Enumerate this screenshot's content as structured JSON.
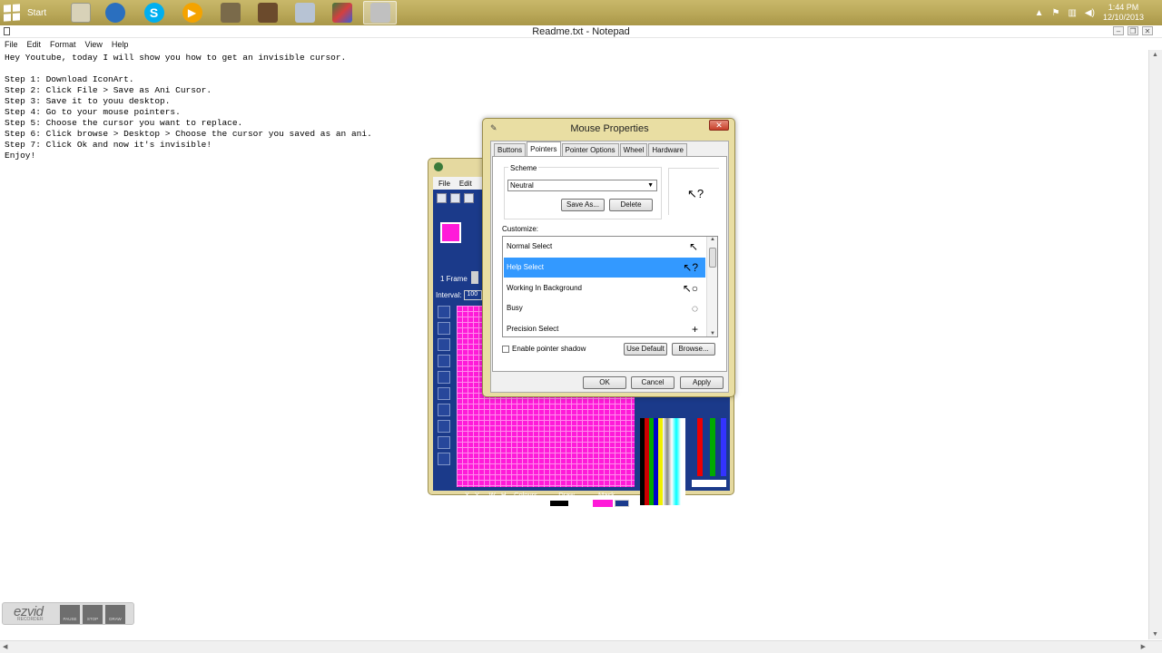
{
  "taskbar": {
    "start_label": "Start",
    "apps": [
      {
        "name": "file-explorer-icon",
        "color": "#d8d2b8"
      },
      {
        "name": "browser-icon",
        "color": "#2a6fbf"
      },
      {
        "name": "skype-icon",
        "color": "#00aff0"
      },
      {
        "name": "media-player-icon",
        "color": "#f4a300"
      },
      {
        "name": "gimp-icon",
        "color": "#7a6a4a"
      },
      {
        "name": "minecraft-icon",
        "color": "#6b4a2c"
      },
      {
        "name": "notepad-icon",
        "color": "#b7c3d4"
      },
      {
        "name": "paint-icon",
        "color": "#3b7a3b"
      },
      {
        "name": "iconart-icon",
        "color": "#c0c0c0"
      }
    ],
    "time": "1:44 PM",
    "date": "12/10/2013"
  },
  "notepad": {
    "title": "Readme.txt - Notepad",
    "menu": [
      "File",
      "Edit",
      "Format",
      "View",
      "Help"
    ],
    "text": "Hey Youtube, today I will show you how to get an invisible cursor.\n\nStep 1: Download IconArt.\nStep 2: Click File > Save as Ani Cursor.\nStep 3: Save it to youu desktop.\nStep 4: Go to your mouse pointers.\nStep 5: Choose the cursor you want to replace.\nStep 6: Click browse > Desktop > Choose the cursor you saved as an ani.\nStep 7: Click Ok and now it's invisible!\nEnjoy!"
  },
  "iconart": {
    "menu": [
      "File",
      "Edit"
    ],
    "frame_label": "1 Frame",
    "interval_label": "Interval:",
    "interval_value": "100",
    "status": {
      "xy_label": "X , Y",
      "xy_value": "(17,1)",
      "wh_label": "W , H",
      "wh_value": "(0,0)",
      "colours_label": "Colours",
      "colours_value": "1",
      "draw_label": "Draw",
      "mask_label": "Mask"
    },
    "current_color": "#ff1ad9"
  },
  "mouse_properties": {
    "title": "Mouse Properties",
    "tabs": [
      "Buttons",
      "Pointers",
      "Pointer Options",
      "Wheel",
      "Hardware"
    ],
    "selected_tab": "Pointers",
    "scheme_label": "Scheme",
    "scheme_value": "Neutral",
    "save_as_label": "Save As...",
    "delete_label": "Delete",
    "customize_label": "Customize:",
    "list": [
      {
        "label": "Normal Select",
        "cursor": "↖"
      },
      {
        "label": "Help Select",
        "cursor": "↖?"
      },
      {
        "label": "Working In Background",
        "cursor": "↖○"
      },
      {
        "label": "Busy",
        "cursor": "◌"
      },
      {
        "label": "Precision Select",
        "cursor": "+"
      }
    ],
    "selected_item": "Help Select",
    "shadow_label": "Enable pointer shadow",
    "use_default_label": "Use Default",
    "browse_label": "Browse...",
    "ok_label": "OK",
    "cancel_label": "Cancel",
    "apply_label": "Apply"
  },
  "ezvid": {
    "logo": "ezvid",
    "sub": "RECORDER",
    "pause_label": "PAUSE",
    "stop_label": "STOP",
    "draw_label": "DRAW"
  }
}
